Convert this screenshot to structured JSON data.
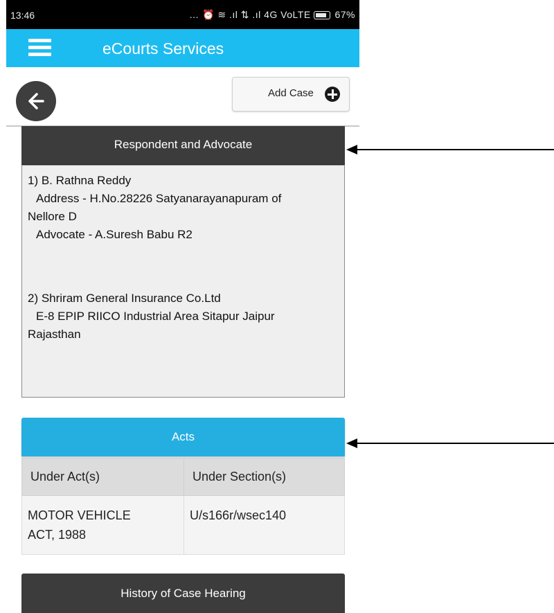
{
  "status_bar": {
    "time": "13:46",
    "indicators": "… ⏰ ≋ .ıl ⇅ .ıl 4G VoLTE",
    "battery": "67%"
  },
  "app_bar": {
    "title": "eCourts Services"
  },
  "toolbar": {
    "add_case_label": "Add Case"
  },
  "respondent_section": {
    "title": "Respondent and Advocate",
    "parties": [
      {
        "name": "1) B. Rathna Reddy",
        "address_line": "Address - H.No.28226 Satyanarayanapuram of",
        "address_cont": "Nellore D",
        "advocate": "Advocate - A.Suresh Babu R2"
      },
      {
        "name": "2) Shriram General Insurance Co.Ltd",
        "address_line": "E-8 EPIP RIICO Industrial Area Sitapur Jaipur",
        "address_cont": "Rajasthan"
      }
    ]
  },
  "acts_section": {
    "title": "Acts",
    "columns": [
      "Under Act(s)",
      "Under Section(s)"
    ],
    "rows": [
      {
        "act_line1": "MOTOR VEHICLE",
        "act_line2": "ACT, 1988",
        "section": "U/s166r/wsec140"
      }
    ]
  },
  "history_section": {
    "title": "History of Case Hearing"
  },
  "colors": {
    "app_bar": "#1dbcf0",
    "acts_header": "#25aee0",
    "dark_header": "#3c3c3c"
  }
}
